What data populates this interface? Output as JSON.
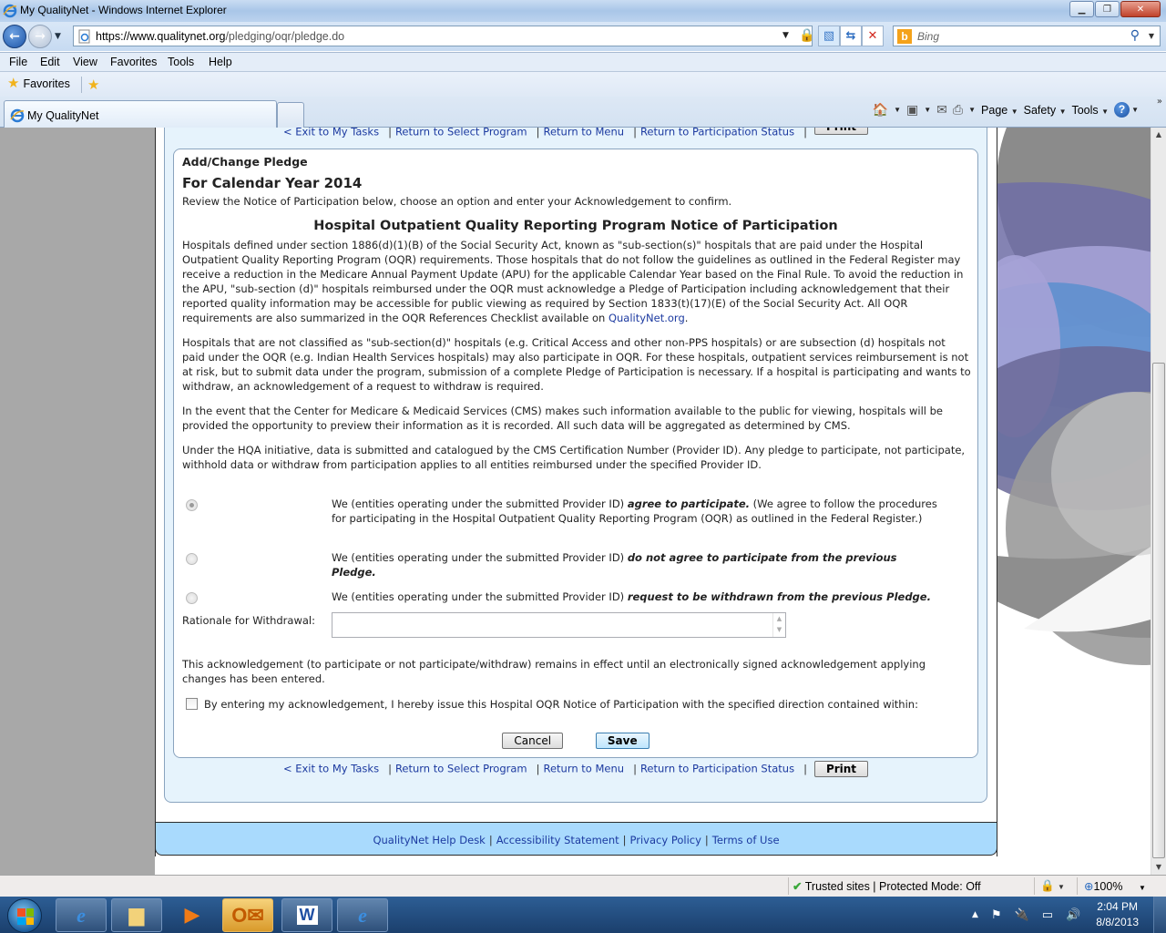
{
  "window": {
    "title": "My QualityNet - Windows Internet Explorer",
    "controls": [
      "minimize",
      "restore",
      "close"
    ]
  },
  "address_bar": {
    "url_scheme_host": "https://www.qualitynet.org",
    "url_path": "/pledging/oqr/pledge.do",
    "security": "lock-icon"
  },
  "search_bar": {
    "provider_logo": "b",
    "placeholder": "Bing"
  },
  "menu": {
    "items": [
      "File",
      "Edit",
      "View",
      "Favorites",
      "Tools",
      "Help"
    ]
  },
  "favorites_bar": {
    "label": "Favorites"
  },
  "tabs": [
    {
      "label": "My QualityNet",
      "active": true
    }
  ],
  "command_bar": {
    "page": "Page",
    "safety": "Safety",
    "tools": "Tools",
    "help": "?"
  },
  "page": {
    "top_nav": {
      "exit": "< Exit to My Tasks",
      "select_program": "Return to Select Program",
      "menu": "Return to Menu",
      "participation_status": "Return to Participation Status",
      "print": "Print"
    },
    "section_title": "Add/Change Pledge",
    "year_title": "For Calendar Year 2014",
    "intro": "Review the Notice of Participation below, choose an option and enter your Acknowledgement to confirm.",
    "notice_title": "Hospital Outpatient Quality Reporting Program Notice of Participation",
    "paragraphs": {
      "p1": "Hospitals defined under section 1886(d)(1)(B) of the Social Security Act, known as \"sub-section(s)\" hospitals that are paid under the Hospital Outpatient Quality Reporting Program (OQR) requirements. Those hospitals that do not follow the guidelines as outlined in the Federal Register may receive a reduction in the Medicare Annual Payment Update (APU) for the applicable Calendar Year based on the Final Rule. To avoid the reduction in the APU, \"sub-section (d)\" hospitals reimbursed under the OQR must acknowledge a Pledge of Participation including acknowledgement that their reported quality information may be accessible for public viewing as required by Section 1833(t)(17)(E) of the Social Security Act. All OQR requirements are also summarized in the OQR References Checklist available on ",
      "p1_link": "QualityNet.org",
      "p1_end": ".",
      "p2": "Hospitals that are not classified as \"sub-section(d)\" hospitals (e.g. Critical Access and other non-PPS hospitals) or are subsection (d) hospitals not paid under the OQR (e.g. Indian Health Services hospitals) may also participate in OQR. For these hospitals, outpatient services reimbursement is not at risk, but to submit data under the program, submission of a complete Pledge of Participation is necessary. If a hospital is participating and wants to withdraw, an acknowledgement of a request to withdraw is required.",
      "p3": "In the event that the Center for Medicare & Medicaid Services (CMS) makes such information available to the public for viewing, hospitals will be provided the opportunity to preview their information as it is recorded. All such data will be aggregated as determined by CMS.",
      "p4": "Under the HQA initiative, data is submitted and catalogued by the CMS Certification Number (Provider ID). Any pledge to participate, not participate, withhold data or withdraw from participation applies to all entities reimbursed under the specified Provider ID."
    },
    "options": [
      {
        "prefix": "We (entities operating under the submitted Provider ID) ",
        "emphasis": "agree to participate.",
        "suffix": " (We agree to follow the procedures for participating in the Hospital Outpatient Quality Reporting Program (OQR) as outlined in the Federal Register.)",
        "selected": true
      },
      {
        "prefix": "We (entities operating under the submitted Provider ID) ",
        "emphasis": "do not agree to participate from the previous Pledge.",
        "suffix": "",
        "selected": false
      },
      {
        "prefix": "We (entities operating under the submitted Provider ID) ",
        "emphasis": "request to be withdrawn from the previous Pledge.",
        "suffix": "",
        "selected": false
      }
    ],
    "rationale": {
      "label": "Rationale for Withdrawal:",
      "value": ""
    },
    "ack_note": "This acknowledgement (to participate or not participate/withdraw) remains in effect until an electronically signed acknowledgement applying changes has been entered.",
    "ack_checkbox": {
      "label": "By entering my acknowledgement, I hereby issue this Hospital OQR Notice of Participation with the specified direction contained within:",
      "checked": false
    },
    "buttons": {
      "cancel": "Cancel",
      "save": "Save"
    },
    "footer": {
      "help_desk": "QualityNet Help Desk",
      "accessibility": "Accessibility Statement",
      "privacy": "Privacy Policy",
      "terms": "Terms of Use"
    }
  },
  "status_bar": {
    "zone": "Trusted sites | Protected Mode: Off",
    "zoom": "100%"
  },
  "taskbar": {
    "apps": [
      "internet-explorer",
      "windows-explorer",
      "media-player",
      "outlook",
      "word",
      "internet-explorer"
    ],
    "clock_time": "2:04 PM",
    "clock_date": "8/8/2013"
  },
  "colors": {
    "link": "#1c3aa0",
    "content_bg": "#e6f3fc",
    "footer_bg": "#a9dafd",
    "left_bg": "#a8a8a8"
  }
}
